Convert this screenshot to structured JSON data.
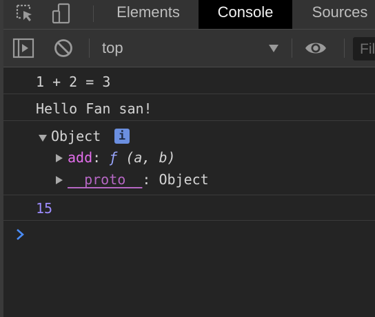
{
  "tabs": [
    {
      "label": "Elements",
      "active": false
    },
    {
      "label": "Console",
      "active": true
    },
    {
      "label": "Sources",
      "active": false
    }
  ],
  "toolbar": {
    "context": "top",
    "filter_placeholder": "Filter"
  },
  "console": {
    "messages": [
      {
        "text": "1 + 2 = 3"
      },
      {
        "text": "Hello Fan san!"
      }
    ],
    "object": {
      "label": "Object",
      "badge": "i",
      "props": [
        {
          "key": "add",
          "sep": ":",
          "func_marker": "ƒ",
          "value": "(a, b)"
        },
        {
          "key": "__proto__",
          "sep": ":",
          "value": "Object"
        }
      ]
    },
    "number_output": "15"
  },
  "colors": {
    "accent_prompt": "#4a8cf7",
    "prop_key": "#e36eec",
    "number": "#9d8cff",
    "badge": "#6b8fe0"
  },
  "icons": [
    "inspect-element-icon",
    "device-toolbar-icon",
    "sidebar-toggle-icon",
    "clear-console-icon",
    "dropdown-arrow-icon",
    "eye-icon",
    "prompt-chevron-icon"
  ]
}
